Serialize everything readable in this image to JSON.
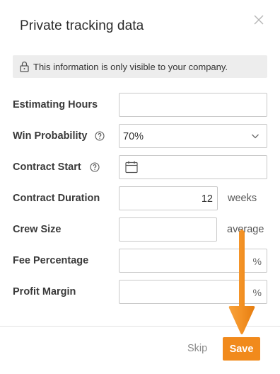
{
  "dialog": {
    "title": "Private tracking data",
    "notice": "This information is only visible to your company."
  },
  "fields": {
    "estimating_hours": {
      "label": "Estimating Hours",
      "value": ""
    },
    "win_probability": {
      "label": "Win Probability",
      "value": "70%"
    },
    "contract_start": {
      "label": "Contract Start",
      "value": ""
    },
    "contract_duration": {
      "label": "Contract Duration",
      "value": "12",
      "suffix": "weeks"
    },
    "crew_size": {
      "label": "Crew Size",
      "value": "",
      "suffix": "average"
    },
    "fee_percentage": {
      "label": "Fee Percentage",
      "value": "",
      "unit": "%"
    },
    "profit_margin": {
      "label": "Profit Margin",
      "value": "",
      "unit": "%"
    }
  },
  "footer": {
    "skip_label": "Skip",
    "save_label": "Save"
  },
  "colors": {
    "accent": "#f18a1c",
    "notice_bg": "#ededed",
    "border": "#c9c9c9"
  },
  "icons": [
    "close-icon",
    "lock-icon",
    "help-icon",
    "chevron-down-icon",
    "calendar-icon",
    "arrow-annotation"
  ]
}
